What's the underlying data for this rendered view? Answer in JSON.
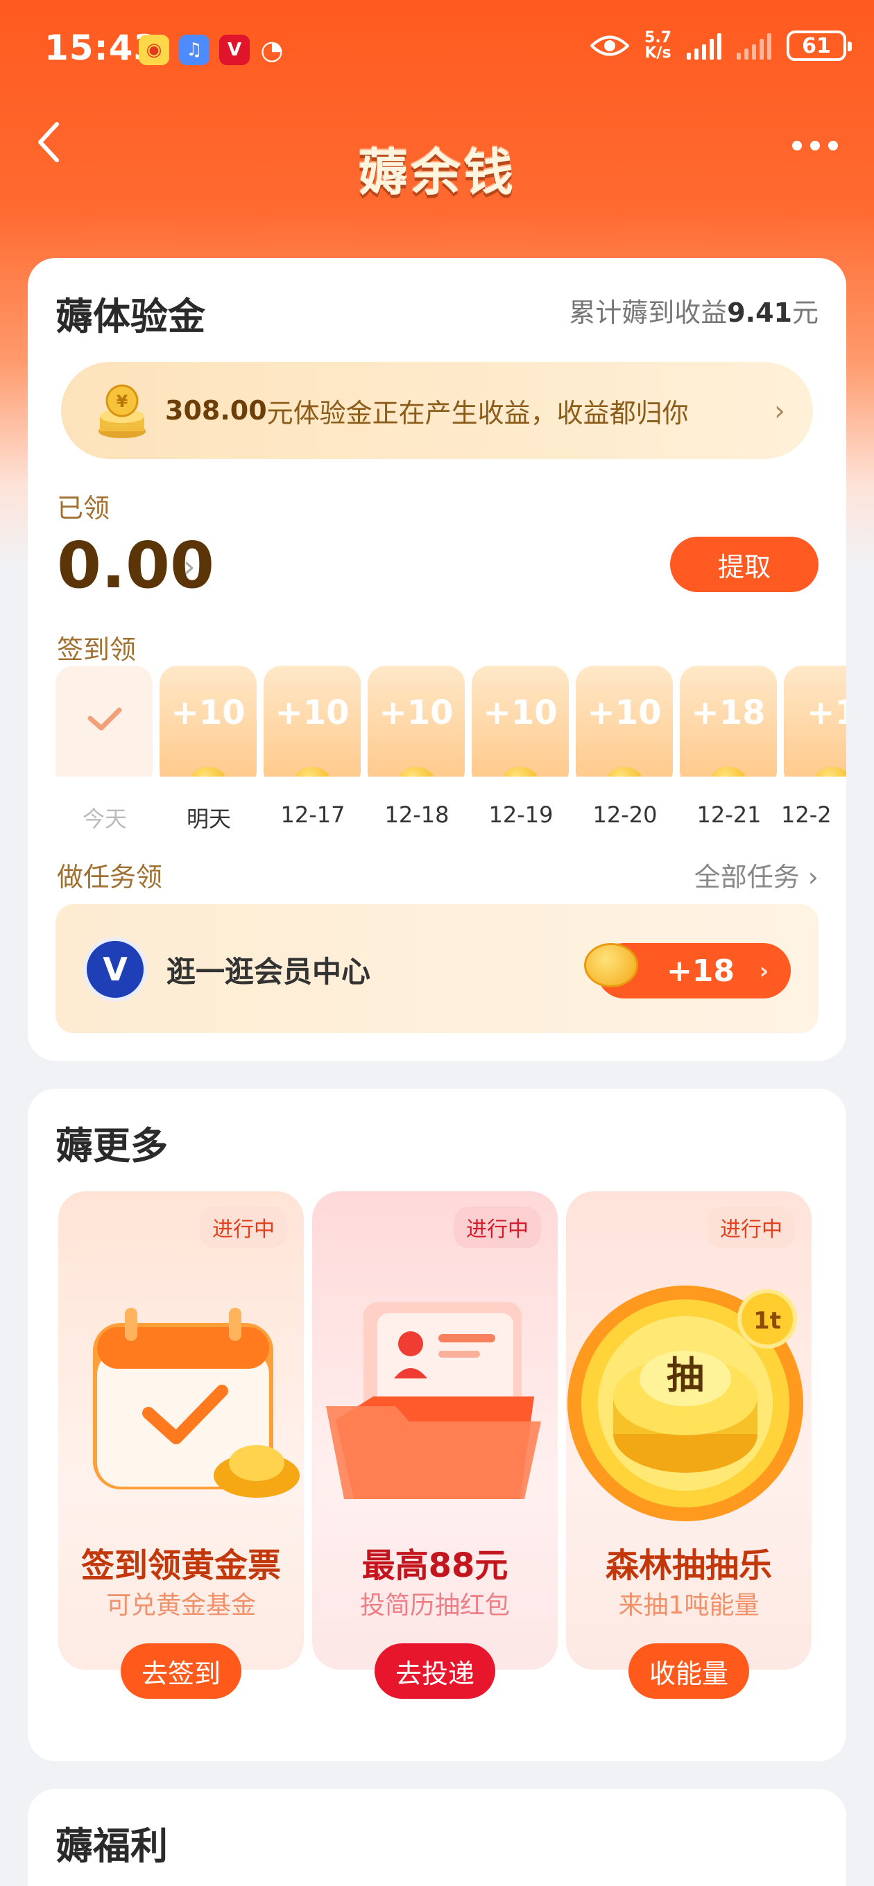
{
  "status_bar": {
    "time": "15:43",
    "speed_value": "5.7",
    "speed_unit": "K/s",
    "battery": "61"
  },
  "header": {
    "title": "薅余钱"
  },
  "experience_card": {
    "title": "薅体验金",
    "earnings_label": "累计薅到收益",
    "earnings_value": "9.41",
    "earnings_unit": "元",
    "notice_amount": "308.00",
    "notice_text": "元体验金正在产生收益，收益都归你",
    "claimed_label": "已领",
    "claimed_value": "0.00",
    "withdraw_label": "提取",
    "checkin_label": "签到领",
    "days": [
      {
        "label": "今天",
        "amount": ""
      },
      {
        "label": "明天",
        "amount": "+10"
      },
      {
        "label": "12-17",
        "amount": "+10"
      },
      {
        "label": "12-18",
        "amount": "+10"
      },
      {
        "label": "12-19",
        "amount": "+10"
      },
      {
        "label": "12-20",
        "amount": "+10"
      },
      {
        "label": "12-21",
        "amount": "+18"
      },
      {
        "label": "12-2",
        "amount": "+1"
      }
    ],
    "task_label": "做任务领",
    "all_tasks_label": "全部任务",
    "task": {
      "name": "逛一逛会员中心",
      "reward": "+18"
    }
  },
  "more_card": {
    "title": "薅更多",
    "promos": [
      {
        "badge": "进行中",
        "title": "签到领黄金票",
        "subtitle": "可兑黄金基金",
        "button": "去签到"
      },
      {
        "badge": "进行中",
        "title": "最高88元",
        "subtitle": "投简历抽红包",
        "button": "去投递"
      },
      {
        "badge": "进行中",
        "title": "森林抽抽乐",
        "subtitle": "来抽1吨能量",
        "button": "收能量",
        "icon_text": "抽",
        "corner_text": "1t"
      }
    ]
  },
  "welfare_card": {
    "title": "薅福利"
  },
  "colors": {
    "brand_orange": "#ff5a22",
    "brand_red": "#e8162c",
    "gold_text": "#5b3408"
  },
  "icons": {
    "back": "chevron-left-icon",
    "more": "more-dots-icon",
    "check": "check-icon",
    "coin": "coin-icon",
    "vip": "vip-logo-icon"
  }
}
